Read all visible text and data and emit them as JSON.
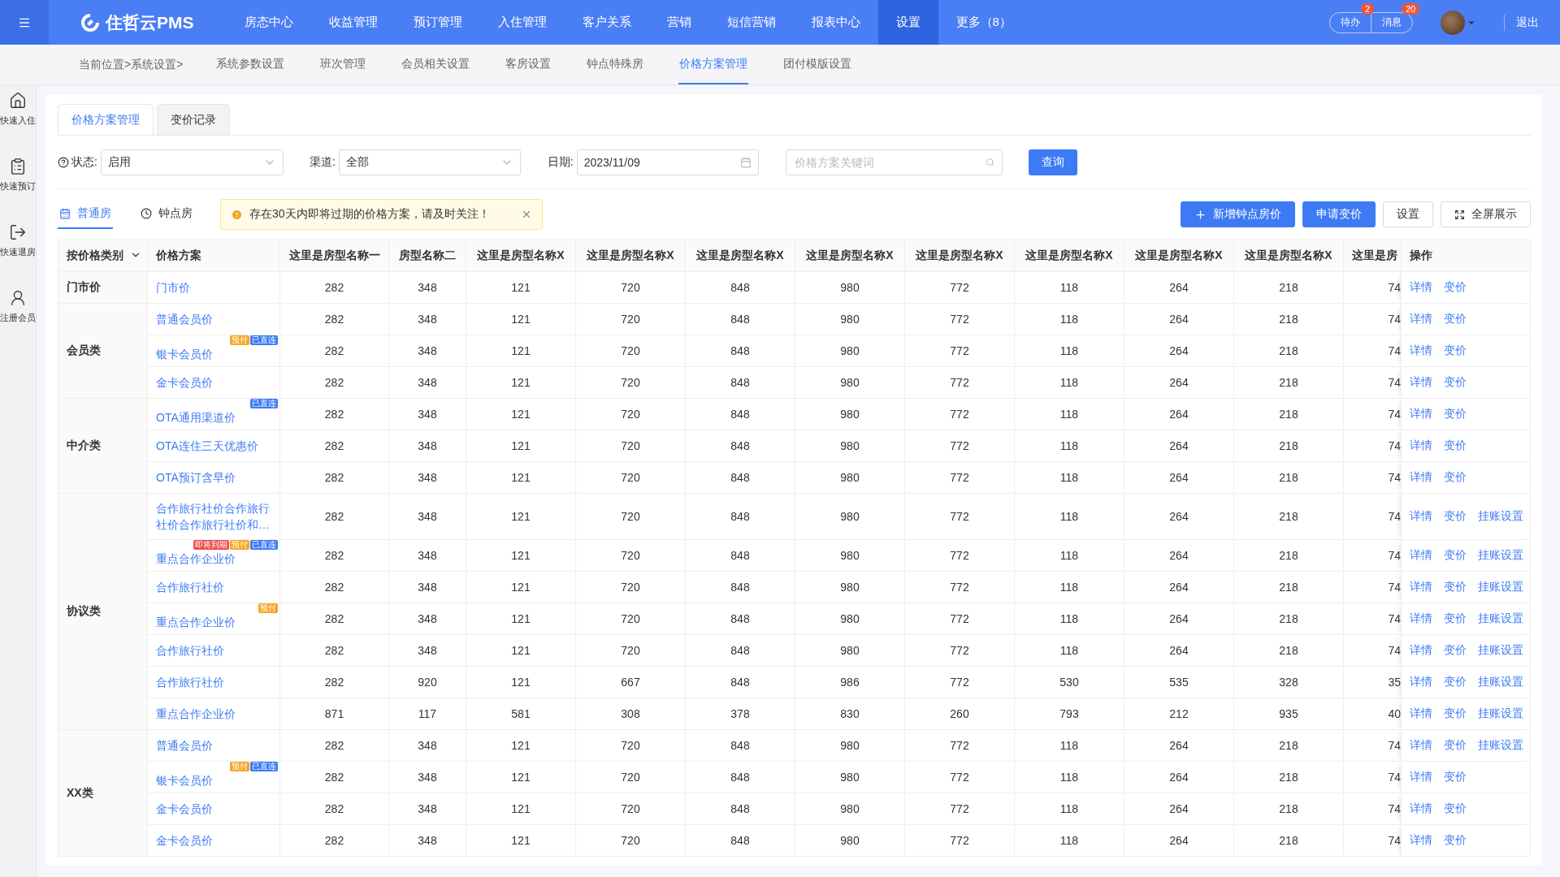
{
  "topbar": {
    "logo": "住哲云PMS",
    "nav": [
      {
        "label": "房态中心",
        "selected": false
      },
      {
        "label": "收益管理",
        "selected": false
      },
      {
        "label": "预订管理",
        "selected": false
      },
      {
        "label": "入住管理",
        "selected": false
      },
      {
        "label": "客户关系",
        "selected": false
      },
      {
        "label": "营销",
        "selected": false
      },
      {
        "label": "短信营销",
        "selected": false
      },
      {
        "label": "报表中心",
        "selected": false
      },
      {
        "label": "设置",
        "selected": true
      },
      {
        "label": "更多（8）",
        "selected": false
      }
    ],
    "todo": {
      "label": "待办",
      "count": "2"
    },
    "messages": {
      "label": "消息",
      "count": "20"
    },
    "logout": "退出"
  },
  "subnav": {
    "breadcrumb": "当前位置>系统设置>",
    "items": [
      {
        "label": "系统参数设置",
        "selected": false
      },
      {
        "label": "班次管理",
        "selected": false
      },
      {
        "label": "会员相关设置",
        "selected": false
      },
      {
        "label": "客房设置",
        "selected": false
      },
      {
        "label": "钟点特殊房",
        "selected": false
      },
      {
        "label": "价格方案管理",
        "selected": true
      },
      {
        "label": "团付模版设置",
        "selected": false
      }
    ]
  },
  "sidebar": [
    {
      "label": "快速入住"
    },
    {
      "label": "快速预订"
    },
    {
      "label": "快速退房"
    },
    {
      "label": "注册会员"
    }
  ],
  "page_tabs": [
    {
      "label": "价格方案管理",
      "selected": true
    },
    {
      "label": "变价记录",
      "selected": false
    }
  ],
  "filters": {
    "status": {
      "label": "状态:",
      "value": "启用"
    },
    "channel": {
      "label": "渠道:",
      "value": "全部"
    },
    "date": {
      "label": "日期:",
      "value": "2023/11/09"
    },
    "keyword": {
      "placeholder": "价格方案关键词"
    },
    "query": "查询"
  },
  "room_tabs": [
    {
      "label": "普通房",
      "selected": true
    },
    {
      "label": "钟点房",
      "selected": false
    }
  ],
  "alert": "存在30天内即将过期的价格方案，请及时关注！",
  "actions": [
    {
      "label": "新增钟点房价",
      "kind": "primary"
    },
    {
      "label": "申请变价",
      "kind": "primary"
    },
    {
      "label": "设置",
      "kind": "plain"
    },
    {
      "label": "全屏展示",
      "kind": "plain"
    }
  ],
  "table": {
    "columns": [
      "按价格类别",
      "价格方案",
      "这里是房型名称一",
      "房型名称二",
      "这里是房型名称X",
      "这里是房型名称X",
      "这里是房型名称X",
      "这里是房型名称X",
      "这里是房型名称X",
      "这里是房型名称X",
      "这里是房型名称X",
      "这里是房型名称X",
      "这里是房",
      "操作"
    ],
    "groups": [
      {
        "category": "门市价",
        "rows": [
          {
            "plan": "门市价",
            "tags": [],
            "values": [
              "282",
              "348",
              "121",
              "720",
              "848",
              "980",
              "772",
              "118",
              "264",
              "218",
              "74"
            ],
            "actions": [
              "详情",
              "变价"
            ]
          }
        ]
      },
      {
        "category": "会员类",
        "rows": [
          {
            "plan": "普通会员价",
            "tags": [],
            "values": [
              "282",
              "348",
              "121",
              "720",
              "848",
              "980",
              "772",
              "118",
              "264",
              "218",
              "74"
            ],
            "actions": [
              "详情",
              "变价"
            ]
          },
          {
            "plan": "银卡会员价",
            "tags": [
              {
                "label": "预付",
                "color": "#f5a623"
              },
              {
                "label": "已直连",
                "color": "#3d7bf5"
              }
            ],
            "values": [
              "282",
              "348",
              "121",
              "720",
              "848",
              "980",
              "772",
              "118",
              "264",
              "218",
              "74"
            ],
            "actions": [
              "详情",
              "变价"
            ]
          },
          {
            "plan": "金卡会员价",
            "tags": [],
            "values": [
              "282",
              "348",
              "121",
              "720",
              "848",
              "980",
              "772",
              "118",
              "264",
              "218",
              "74"
            ],
            "actions": [
              "详情",
              "变价"
            ]
          }
        ]
      },
      {
        "category": "中介类",
        "rows": [
          {
            "plan": "OTA通用渠道价",
            "tags": [
              {
                "label": "已直连",
                "color": "#3d7bf5"
              }
            ],
            "values": [
              "282",
              "348",
              "121",
              "720",
              "848",
              "980",
              "772",
              "118",
              "264",
              "218",
              "74"
            ],
            "actions": [
              "详情",
              "变价"
            ]
          },
          {
            "plan": "OTA连住三天优惠价",
            "tags": [],
            "values": [
              "282",
              "348",
              "121",
              "720",
              "848",
              "980",
              "772",
              "118",
              "264",
              "218",
              "74"
            ],
            "actions": [
              "详情",
              "变价"
            ]
          },
          {
            "plan": "OTA预订含早价",
            "tags": [],
            "values": [
              "282",
              "348",
              "121",
              "720",
              "848",
              "980",
              "772",
              "118",
              "264",
              "218",
              "74"
            ],
            "actions": [
              "详情",
              "变价"
            ]
          }
        ]
      },
      {
        "category": "协议类",
        "rows": [
          {
            "plan": "合作旅行社价合作旅行社价合作旅行社价和…",
            "tags": [],
            "values": [
              "282",
              "348",
              "121",
              "720",
              "848",
              "980",
              "772",
              "118",
              "264",
              "218",
              "74"
            ],
            "actions": [
              "详情",
              "变价",
              "挂账设置"
            ]
          },
          {
            "plan": "重点合作企业价",
            "tags": [
              {
                "label": "即将到期",
                "color": "#f04b4b"
              },
              {
                "label": "预付",
                "color": "#f5a623"
              },
              {
                "label": "已直连",
                "color": "#3d7bf5"
              }
            ],
            "values": [
              "282",
              "348",
              "121",
              "720",
              "848",
              "980",
              "772",
              "118",
              "264",
              "218",
              "74"
            ],
            "actions": [
              "详情",
              "变价",
              "挂账设置"
            ]
          },
          {
            "plan": "合作旅行社价",
            "tags": [],
            "values": [
              "282",
              "348",
              "121",
              "720",
              "848",
              "980",
              "772",
              "118",
              "264",
              "218",
              "74"
            ],
            "actions": [
              "详情",
              "变价",
              "挂账设置"
            ]
          },
          {
            "plan": "重点合作企业价",
            "tags": [
              {
                "label": "预付",
                "color": "#f5a623"
              }
            ],
            "values": [
              "282",
              "348",
              "121",
              "720",
              "848",
              "980",
              "772",
              "118",
              "264",
              "218",
              "74"
            ],
            "actions": [
              "详情",
              "变价",
              "挂账设置"
            ]
          },
          {
            "plan": "合作旅行社价",
            "tags": [],
            "values": [
              "282",
              "348",
              "121",
              "720",
              "848",
              "980",
              "772",
              "118",
              "264",
              "218",
              "74"
            ],
            "actions": [
              "详情",
              "变价",
              "挂账设置"
            ]
          },
          {
            "plan": "合作旅行社价",
            "tags": [],
            "values": [
              "282",
              "920",
              "121",
              "667",
              "848",
              "986",
              "772",
              "530",
              "535",
              "328",
              "35"
            ],
            "actions": [
              "详情",
              "变价",
              "挂账设置"
            ]
          },
          {
            "plan": "重点合作企业价",
            "tags": [],
            "values": [
              "871",
              "117",
              "581",
              "308",
              "378",
              "830",
              "260",
              "793",
              "212",
              "935",
              "40"
            ],
            "actions": [
              "详情",
              "变价",
              "挂账设置"
            ]
          }
        ]
      },
      {
        "category": "XX类",
        "rows": [
          {
            "plan": "普通会员价",
            "tags": [],
            "values": [
              "282",
              "348",
              "121",
              "720",
              "848",
              "980",
              "772",
              "118",
              "264",
              "218",
              "74"
            ],
            "actions": [
              "详情",
              "变价",
              "挂账设置"
            ]
          },
          {
            "plan": "银卡会员价",
            "tags": [
              {
                "label": "预付",
                "color": "#f5a623"
              },
              {
                "label": "已直连",
                "color": "#3d7bf5"
              }
            ],
            "values": [
              "282",
              "348",
              "121",
              "720",
              "848",
              "980",
              "772",
              "118",
              "264",
              "218",
              "74"
            ],
            "actions": [
              "详情",
              "变价"
            ]
          },
          {
            "plan": "金卡会员价",
            "tags": [],
            "values": [
              "282",
              "348",
              "121",
              "720",
              "848",
              "980",
              "772",
              "118",
              "264",
              "218",
              "74"
            ],
            "actions": [
              "详情",
              "变价"
            ]
          },
          {
            "plan": "金卡会员价",
            "tags": [],
            "values": [
              "282",
              "348",
              "121",
              "720",
              "848",
              "980",
              "772",
              "118",
              "264",
              "218",
              "74"
            ],
            "actions": [
              "详情",
              "变价"
            ]
          }
        ]
      }
    ]
  }
}
